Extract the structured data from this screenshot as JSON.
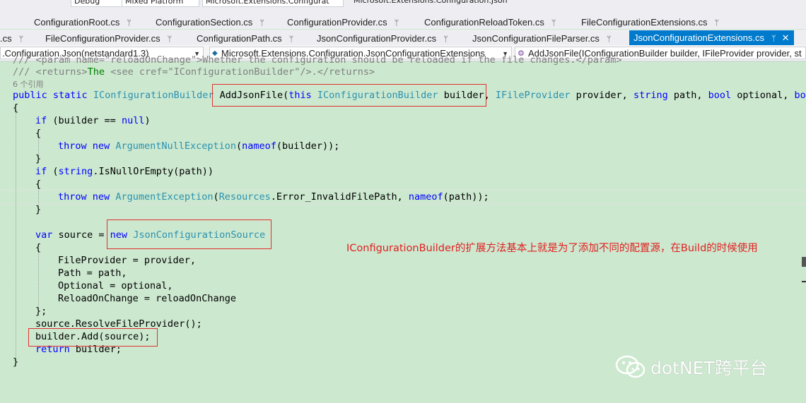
{
  "toolbar": {
    "config": "Debug",
    "platform": "Mixed Platform",
    "project": "Microsoft.Extensions.Configurat",
    "start": "Microsoft.Extensions.Configuration.Json"
  },
  "tabs_row1": [
    {
      "label": "ConfigurationRoot.cs"
    },
    {
      "label": "ConfigurationSection.cs"
    },
    {
      "label": "ConfigurationProvider.cs"
    },
    {
      "label": "ConfigurationReloadToken.cs"
    },
    {
      "label": "FileConfigurationExtensions.cs"
    }
  ],
  "tabs_row2": [
    {
      "label": ".cs"
    },
    {
      "label": "FileConfigurationProvider.cs"
    },
    {
      "label": "ConfigurationPath.cs"
    },
    {
      "label": "JsonConfigurationProvider.cs"
    },
    {
      "label": "JsonConfigurationFileParser.cs"
    },
    {
      "label": "JsonConfigurationExtensions.cs"
    }
  ],
  "navbar": {
    "project": ".Configuration.Json(netstandard1.3)",
    "type": "Microsoft.Extensions.Configuration.JsonConfigurationExtensions",
    "member": "AddJsonFile(IConfigurationBuilder builder, IFileProvider provider, st"
  },
  "code": {
    "l0_a": "/// <param name=\"reloadOnChange\">Whether the configuration should be reloaded if the file changes.</param>",
    "l1_a": "/// <returns>",
    "l1_b": "The ",
    "l1_c": "<see cref=",
    "l1_d": "\"IConfigurationBuilder\"",
    "l1_e": "/>.",
    "l1_f": "</returns>",
    "refs": "6 个引用",
    "sig_public": "public",
    "sig_static": "static",
    "sig_ret": "IConfigurationBuilder",
    "sig_name": "AddJsonFile(",
    "sig_this": "this",
    "sig_t1": "IConfigurationBuilder",
    "sig_p1": " builder,",
    "sig_t2": "IFileProvider",
    "sig_p2": " provider, ",
    "sig_string": "string",
    "sig_p3": " path, ",
    "sig_bool": "bool",
    "sig_p4": " optional, ",
    "sig_bool2": "bool",
    "brace_open": "{",
    "brace_close": "}",
    "if1_kw": "if",
    "if1_a": " (builder == ",
    "null": "null",
    "if1_b": ")",
    "throw": "throw",
    "new": "new",
    "ane": "ArgumentNullException",
    "paren": "(",
    "nameof": "nameof",
    "ane_b": "(builder));",
    "if2_kw": "if",
    "if2_a": " (",
    "string": "string",
    "if2_b": ".IsNullOrEmpty(path))",
    "ae": "ArgumentException",
    "resources": "Resources",
    "ae_b": ".Error_InvalidFilePath, ",
    "ae_c": "(path));",
    "var": "var",
    "src_a": " source = ",
    "jcs": "JsonConfigurationSource",
    "fp": "FileProvider = provider,",
    "path": "Path = path,",
    "opt": "Optional = optional,",
    "roc": "ReloadOnChange = reloadOnChange",
    "close_semi": "};",
    "resolve": "source.ResolveFileProvider();",
    "add": "builder.Add(source);",
    "return": "return",
    "ret_b": " builder;"
  },
  "annotation": "IConfigurationBuilder的扩展方法基本上就是为了添加不同的配置源，在Build的时候使用",
  "watermark": "dotNET跨平台"
}
